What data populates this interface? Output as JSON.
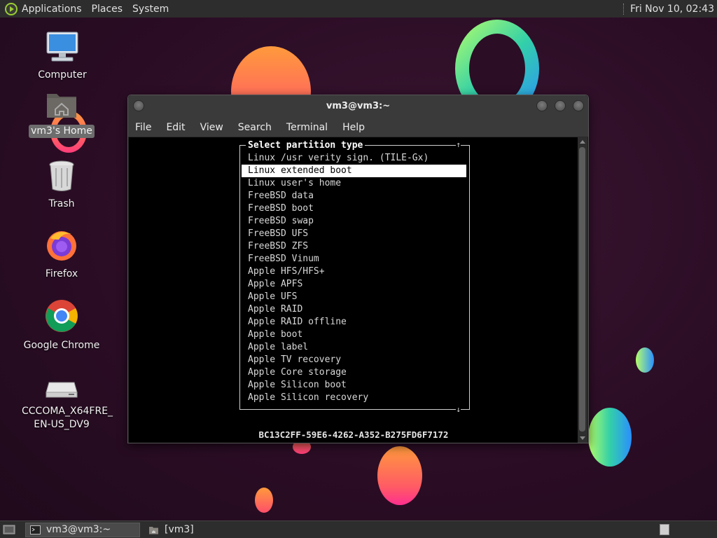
{
  "top_panel": {
    "menus": [
      "Applications",
      "Places",
      "System"
    ],
    "clock": "Fri Nov 10, 02:43"
  },
  "desktop_icons": [
    {
      "label": "Computer",
      "icon": "computer-icon"
    },
    {
      "label": "vm3's Home",
      "icon": "home-folder-icon",
      "selected": true
    },
    {
      "label": "Trash",
      "icon": "trash-icon"
    },
    {
      "label": "Firefox",
      "icon": "firefox-icon"
    },
    {
      "label": "Google Chrome",
      "icon": "chrome-icon"
    },
    {
      "label": "CCCOMA_X64FRE_\nEN-US_DV9",
      "line1": "CCCOMA_X64FRE_",
      "line2": "EN-US_DV9",
      "icon": "drive-icon"
    }
  ],
  "terminal": {
    "title": "vm3@vm3:~",
    "menu": [
      "File",
      "Edit",
      "View",
      "Search",
      "Terminal",
      "Help"
    ],
    "dialog": {
      "title": "Select partition type",
      "selected_index": 1,
      "options": [
        "Linux /usr verity sign. (TILE-Gx)",
        "Linux extended boot",
        "Linux user's home",
        "FreeBSD data",
        "FreeBSD boot",
        "FreeBSD swap",
        "FreeBSD UFS",
        "FreeBSD ZFS",
        "FreeBSD Vinum",
        "Apple HFS/HFS+",
        "Apple APFS",
        "Apple UFS",
        "Apple RAID",
        "Apple RAID offline",
        "Apple boot",
        "Apple label",
        "Apple TV recovery",
        "Apple Core storage",
        "Apple Silicon boot",
        "Apple Silicon recovery"
      ],
      "scroll_up": "↑",
      "scroll_down": "↓"
    },
    "guid": "BC13C2FF-59E6-4262-A352-B275FD6F7172"
  },
  "bottom_panel": {
    "tasks": [
      {
        "label": "vm3@vm3:~",
        "active": true
      },
      {
        "label": "[vm3]",
        "active": false
      }
    ]
  }
}
